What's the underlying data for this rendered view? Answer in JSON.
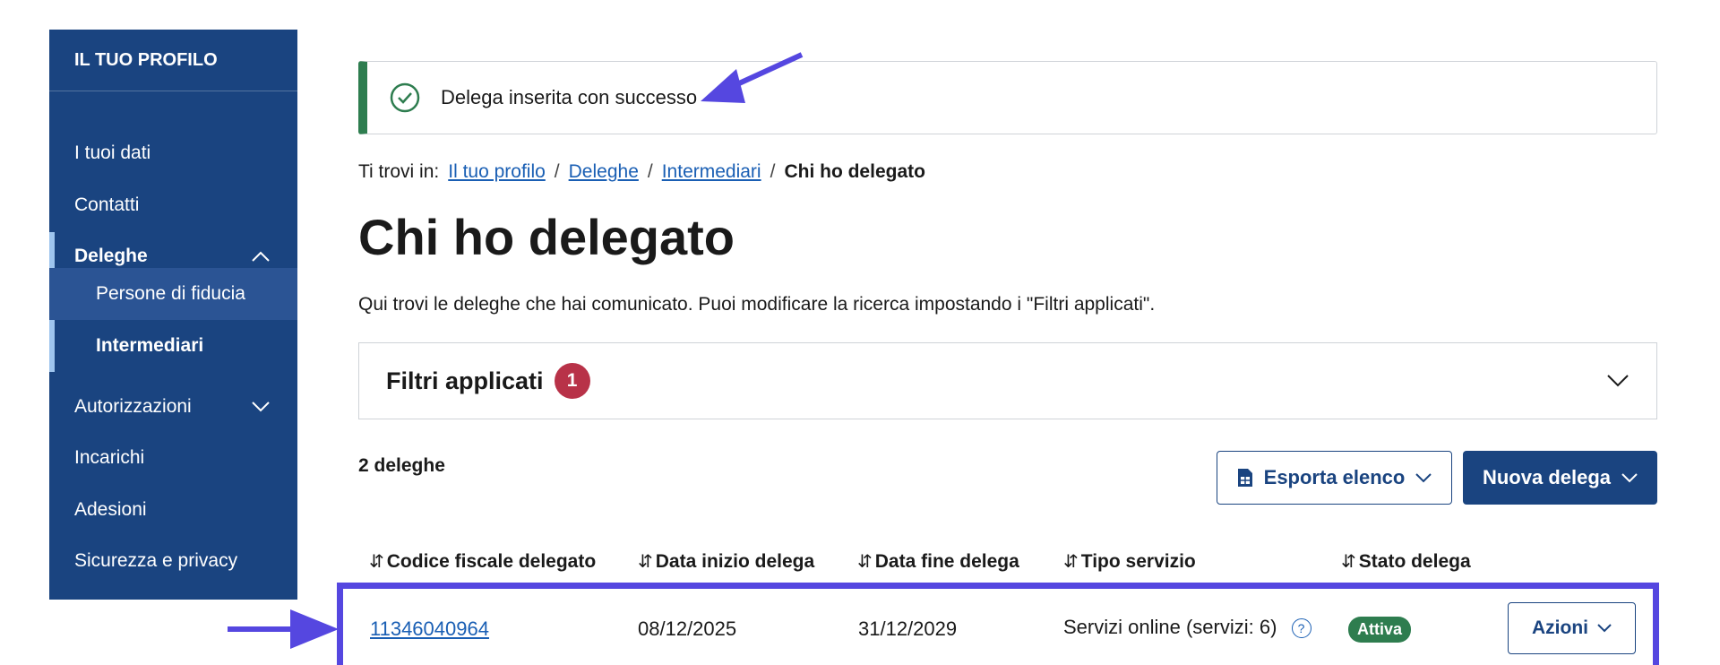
{
  "sidebar": {
    "title": "IL TUO PROFILO",
    "items": [
      {
        "label": "I tuoi dati"
      },
      {
        "label": "Contatti"
      },
      {
        "label": "Deleghe"
      },
      {
        "label": "Persone di fiducia"
      },
      {
        "label": "Intermediari"
      },
      {
        "label": "Autorizzazioni"
      },
      {
        "label": "Incarichi"
      },
      {
        "label": "Adesioni"
      },
      {
        "label": "Sicurezza e privacy"
      }
    ]
  },
  "alert": {
    "message": "Delega inserita con successo",
    "color": "#2e7d4f"
  },
  "breadcrumb": {
    "prefix": "Ti trovi in:",
    "items": [
      "Il tuo profilo",
      "Deleghe",
      "Intermediari"
    ],
    "separator": "/",
    "current": "Chi ho delegato"
  },
  "page": {
    "title": "Chi ho delegato",
    "description": "Qui trovi le deleghe che hai comunicato. Puoi modificare la ricerca impostando i \"Filtri applicati\"."
  },
  "filters": {
    "label": "Filtri applicati",
    "count": "1"
  },
  "results": {
    "count_label": "2 deleghe"
  },
  "toolbar": {
    "export_label": "Esporta elenco",
    "new_label": "Nuova delega"
  },
  "table": {
    "columns": [
      "Codice fiscale delegato",
      "Data inizio delega",
      "Data fine delega",
      "Tipo servizio",
      "Stato delega"
    ],
    "rows": [
      {
        "codice": "11346040964",
        "inizio": "08/12/2025",
        "fine": "31/12/2029",
        "tipo": "Servizi online (servizi: 6)",
        "stato": "Attiva",
        "azioni": "Azioni"
      }
    ]
  },
  "colors": {
    "brand": "#1a4480",
    "accent": "#5547e0",
    "danger": "#b83248",
    "success": "#2e7d4f"
  }
}
